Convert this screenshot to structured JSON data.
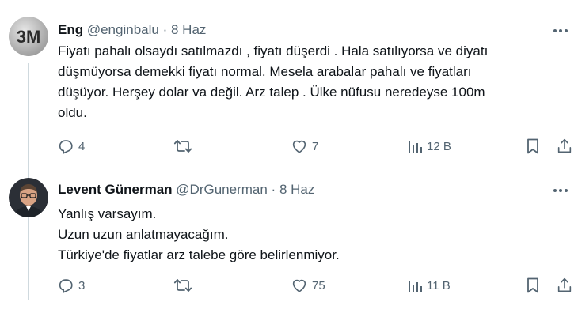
{
  "tweets": [
    {
      "author_name": "Eng",
      "handle": "@enginbalu",
      "separator": "·",
      "date": "8 Haz",
      "avatar_label": "3M",
      "text_lines": [
        "Fiyatı pahalı olsaydı satılmazdı , fiyatı düşerdi . Hala satılıyorsa ve diyatı",
        "düşmüyorsa demekki fiyatı normal. Mesela arabalar pahalı ve fiyatları",
        "düşüyor.  Herşey dolar va değil. Arz talep . Ülke nüfusu neredeyse 100m",
        "oldu."
      ],
      "replies": "4",
      "retweets": "",
      "likes": "7",
      "views": "12 B"
    },
    {
      "author_name": "Levent Günerman",
      "handle": "@DrGunerman",
      "separator": "·",
      "date": "8 Haz",
      "text_lines": [
        "Yanlış varsayım.",
        "Uzun uzun anlatmayacağım.",
        "Türkiye'de fiyatlar arz talebe göre belirlenmiyor."
      ],
      "replies": "3",
      "retweets": "",
      "likes": "75",
      "views": "11 B"
    }
  ],
  "colors": {
    "text": "#0f1419",
    "secondary": "#536471",
    "thread_line": "#cfd9de"
  },
  "icons": [
    "reply-icon",
    "retweet-icon",
    "like-icon",
    "views-icon",
    "bookmark-icon",
    "share-icon",
    "more-icon"
  ]
}
